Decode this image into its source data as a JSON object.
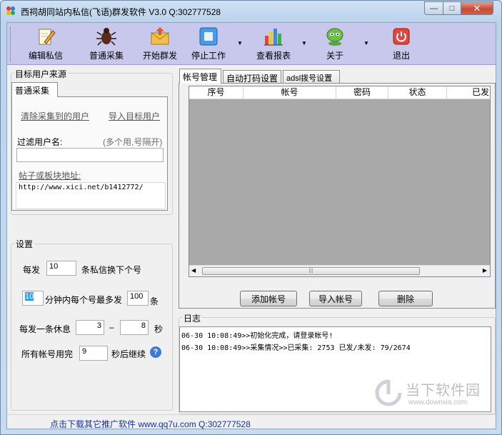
{
  "window": {
    "title": "西祠胡同站内私信(飞语)群发软件  V3.0  Q:302777528",
    "min_glyph": "—",
    "max_glyph": "□",
    "close_glyph": "✕"
  },
  "toolbar": {
    "items": [
      {
        "label": "编辑私信",
        "icon": "edit-pencil-icon"
      },
      {
        "label": "普通采集",
        "icon": "bug-icon"
      },
      {
        "label": "开始群发",
        "icon": "envelope-icon"
      },
      {
        "label": "停止工作",
        "icon": "stop-square-icon"
      },
      {
        "label": "查看报表",
        "icon": "bar-chart-icon"
      },
      {
        "label": "关于",
        "icon": "alien-icon"
      },
      {
        "label": "退出",
        "icon": "power-icon"
      }
    ],
    "dropdown_glyph": "▼"
  },
  "source": {
    "group_title": "目标用户来源",
    "tab": "普通采集",
    "clear_link": "清除采集到的用户",
    "import_link": "导入目标用户",
    "filter_label": "过滤用户名:",
    "filter_hint": "(多个用,号隔开)",
    "filter_value": "",
    "url_label": "帖子或板块地址:",
    "url_value": "http://www.xici.net/b1412772/"
  },
  "settings": {
    "group_title": "设置",
    "row1_prefix": "每发",
    "row1_value": "10",
    "row1_suffix": "条私信换下个号",
    "row2_value": "10",
    "row2_mid": "分钟内每个号最多发",
    "row2_value2": "100",
    "row2_suffix": "条",
    "row3_prefix": "每发一条休息",
    "row3_min": "3",
    "row3_dash": "–",
    "row3_max": "8",
    "row3_suffix": "秒",
    "row4_prefix": "所有帐号用完",
    "row4_value": "9",
    "row4_suffix": "秒后继续",
    "help_glyph": "?"
  },
  "accounts": {
    "tabs": [
      "帐号管理",
      "自动打码设置",
      "adsl拨号设置"
    ],
    "columns": [
      "序号",
      "帐号",
      "密码",
      "状态",
      "已发"
    ],
    "add_button": "添加帐号",
    "import_button": "导入帐号",
    "delete_button": "删除",
    "scroll_left": "◀",
    "scroll_right": "▶",
    "scroll_grip": "|||"
  },
  "log": {
    "group_title": "日志",
    "lines": [
      "06-30 10:08:49>>初始化完成，请登录帐号!",
      "06-30 10:08:49>>采集情况>>已采集: 2753 已发/未发: 79/2674"
    ]
  },
  "status": {
    "text": "点击下载其它推广软件  www.qq7u.com  Q:302777528"
  },
  "watermark": {
    "brand": "当下软件园",
    "url": "www.downxia.com"
  }
}
